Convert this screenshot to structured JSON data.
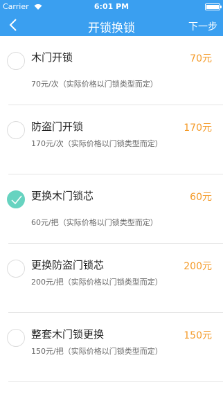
{
  "status": {
    "carrier": "Carrier",
    "time": "6:01 PM",
    "battery_level": 1.0
  },
  "nav": {
    "title": "开锁换锁",
    "next_label": "下一步"
  },
  "items": [
    {
      "name": "木门开锁",
      "price": "70元",
      "desc": "70元/次（实际价格以门锁类型而定）",
      "checked": false
    },
    {
      "name": "防盗门开锁",
      "price": "170元",
      "desc": "170元/次（实际价格以门锁类型而定）",
      "checked": false
    },
    {
      "name": "更换木门锁芯",
      "price": "60元",
      "desc": "60元/把（实际价格以门锁类型而定）",
      "checked": true
    },
    {
      "name": "更换防盗门锁芯",
      "price": "200元",
      "desc": "200元/把（实际价格以门锁类型而定）",
      "checked": false
    },
    {
      "name": "整套木门锁更换",
      "price": "150元",
      "desc": "150元/把（实际价格以门锁类型而定）",
      "checked": false
    }
  ],
  "colors": {
    "nav_bg": "#3a9ff0",
    "price": "#f49a28",
    "check_accent": "#67d3c0"
  },
  "icons": {
    "back": "chevron-left-icon",
    "wifi": "wifi-icon",
    "battery": "battery-icon",
    "check": "checkmark-icon"
  }
}
